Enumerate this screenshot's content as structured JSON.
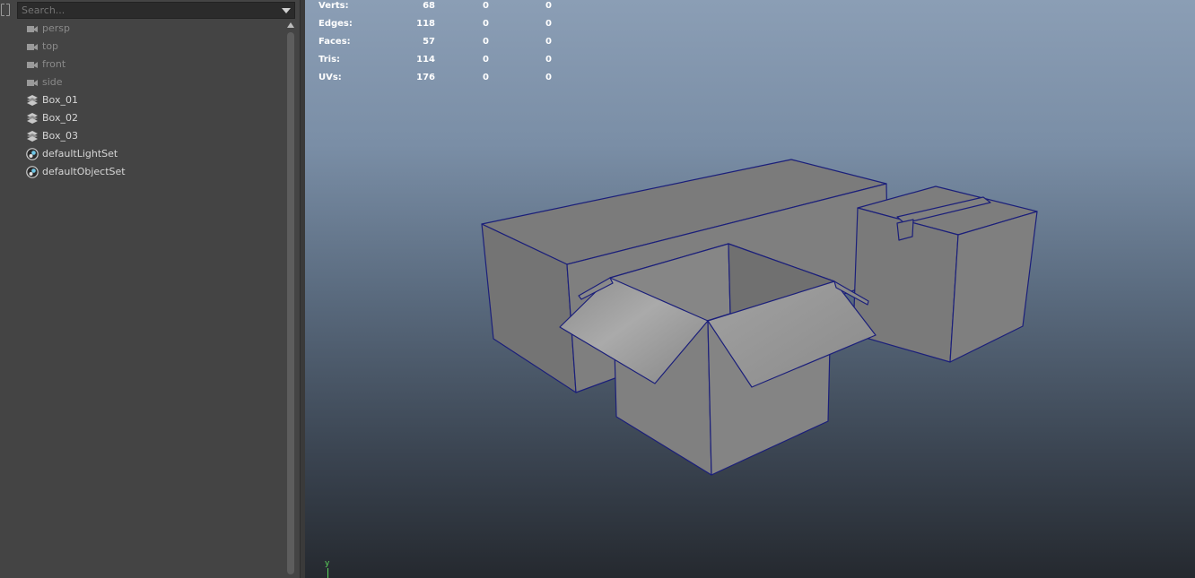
{
  "outliner": {
    "search_placeholder": "Search...",
    "items": [
      {
        "label": "persp",
        "icon": "camera-icon",
        "dim": true
      },
      {
        "label": "top",
        "icon": "camera-icon",
        "dim": true
      },
      {
        "label": "front",
        "icon": "camera-icon",
        "dim": true
      },
      {
        "label": "side",
        "icon": "camera-icon",
        "dim": true
      },
      {
        "label": "Box_01",
        "icon": "mesh-icon",
        "dim": false
      },
      {
        "label": "Box_02",
        "icon": "mesh-icon",
        "dim": false
      },
      {
        "label": "Box_03",
        "icon": "mesh-icon",
        "dim": false
      },
      {
        "label": "defaultLightSet",
        "icon": "set-icon",
        "dim": false
      },
      {
        "label": "defaultObjectSet",
        "icon": "set-icon",
        "dim": false
      }
    ]
  },
  "hud": {
    "rows": [
      {
        "label": "Verts:",
        "values": [
          "68",
          "0",
          "0"
        ]
      },
      {
        "label": "Edges:",
        "values": [
          "118",
          "0",
          "0"
        ]
      },
      {
        "label": "Faces:",
        "values": [
          "57",
          "0",
          "0"
        ]
      },
      {
        "label": "Tris:",
        "values": [
          "114",
          "0",
          "0"
        ]
      },
      {
        "label": "UVs:",
        "values": [
          "176",
          "0",
          "0"
        ]
      }
    ]
  },
  "viewport": {
    "axis_label": "y",
    "colors": {
      "wireframe": "#1b1f7a",
      "box_face": "#7e7e7e",
      "axis": "#5cd65c"
    }
  }
}
